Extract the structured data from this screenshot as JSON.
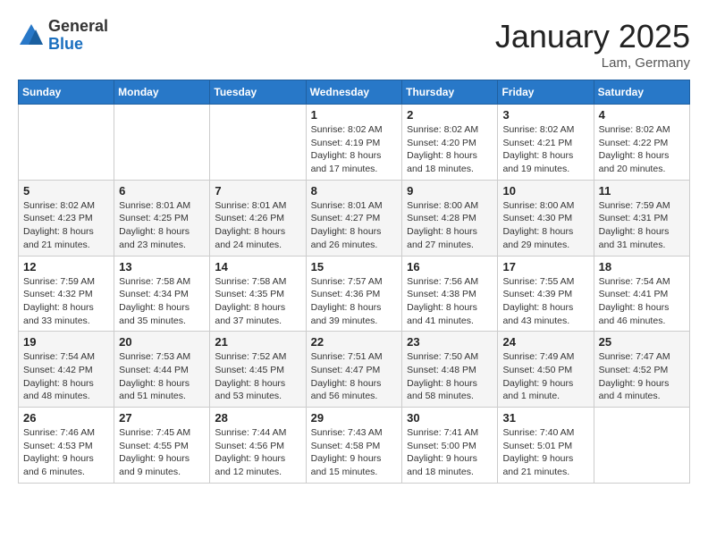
{
  "logo": {
    "general": "General",
    "blue": "Blue"
  },
  "header": {
    "month": "January 2025",
    "location": "Lam, Germany"
  },
  "weekdays": [
    "Sunday",
    "Monday",
    "Tuesday",
    "Wednesday",
    "Thursday",
    "Friday",
    "Saturday"
  ],
  "weeks": [
    [
      {
        "day": "",
        "info": ""
      },
      {
        "day": "",
        "info": ""
      },
      {
        "day": "",
        "info": ""
      },
      {
        "day": "1",
        "info": "Sunrise: 8:02 AM\nSunset: 4:19 PM\nDaylight: 8 hours\nand 17 minutes."
      },
      {
        "day": "2",
        "info": "Sunrise: 8:02 AM\nSunset: 4:20 PM\nDaylight: 8 hours\nand 18 minutes."
      },
      {
        "day": "3",
        "info": "Sunrise: 8:02 AM\nSunset: 4:21 PM\nDaylight: 8 hours\nand 19 minutes."
      },
      {
        "day": "4",
        "info": "Sunrise: 8:02 AM\nSunset: 4:22 PM\nDaylight: 8 hours\nand 20 minutes."
      }
    ],
    [
      {
        "day": "5",
        "info": "Sunrise: 8:02 AM\nSunset: 4:23 PM\nDaylight: 8 hours\nand 21 minutes."
      },
      {
        "day": "6",
        "info": "Sunrise: 8:01 AM\nSunset: 4:25 PM\nDaylight: 8 hours\nand 23 minutes."
      },
      {
        "day": "7",
        "info": "Sunrise: 8:01 AM\nSunset: 4:26 PM\nDaylight: 8 hours\nand 24 minutes."
      },
      {
        "day": "8",
        "info": "Sunrise: 8:01 AM\nSunset: 4:27 PM\nDaylight: 8 hours\nand 26 minutes."
      },
      {
        "day": "9",
        "info": "Sunrise: 8:00 AM\nSunset: 4:28 PM\nDaylight: 8 hours\nand 27 minutes."
      },
      {
        "day": "10",
        "info": "Sunrise: 8:00 AM\nSunset: 4:30 PM\nDaylight: 8 hours\nand 29 minutes."
      },
      {
        "day": "11",
        "info": "Sunrise: 7:59 AM\nSunset: 4:31 PM\nDaylight: 8 hours\nand 31 minutes."
      }
    ],
    [
      {
        "day": "12",
        "info": "Sunrise: 7:59 AM\nSunset: 4:32 PM\nDaylight: 8 hours\nand 33 minutes."
      },
      {
        "day": "13",
        "info": "Sunrise: 7:58 AM\nSunset: 4:34 PM\nDaylight: 8 hours\nand 35 minutes."
      },
      {
        "day": "14",
        "info": "Sunrise: 7:58 AM\nSunset: 4:35 PM\nDaylight: 8 hours\nand 37 minutes."
      },
      {
        "day": "15",
        "info": "Sunrise: 7:57 AM\nSunset: 4:36 PM\nDaylight: 8 hours\nand 39 minutes."
      },
      {
        "day": "16",
        "info": "Sunrise: 7:56 AM\nSunset: 4:38 PM\nDaylight: 8 hours\nand 41 minutes."
      },
      {
        "day": "17",
        "info": "Sunrise: 7:55 AM\nSunset: 4:39 PM\nDaylight: 8 hours\nand 43 minutes."
      },
      {
        "day": "18",
        "info": "Sunrise: 7:54 AM\nSunset: 4:41 PM\nDaylight: 8 hours\nand 46 minutes."
      }
    ],
    [
      {
        "day": "19",
        "info": "Sunrise: 7:54 AM\nSunset: 4:42 PM\nDaylight: 8 hours\nand 48 minutes."
      },
      {
        "day": "20",
        "info": "Sunrise: 7:53 AM\nSunset: 4:44 PM\nDaylight: 8 hours\nand 51 minutes."
      },
      {
        "day": "21",
        "info": "Sunrise: 7:52 AM\nSunset: 4:45 PM\nDaylight: 8 hours\nand 53 minutes."
      },
      {
        "day": "22",
        "info": "Sunrise: 7:51 AM\nSunset: 4:47 PM\nDaylight: 8 hours\nand 56 minutes."
      },
      {
        "day": "23",
        "info": "Sunrise: 7:50 AM\nSunset: 4:48 PM\nDaylight: 8 hours\nand 58 minutes."
      },
      {
        "day": "24",
        "info": "Sunrise: 7:49 AM\nSunset: 4:50 PM\nDaylight: 9 hours\nand 1 minute."
      },
      {
        "day": "25",
        "info": "Sunrise: 7:47 AM\nSunset: 4:52 PM\nDaylight: 9 hours\nand 4 minutes."
      }
    ],
    [
      {
        "day": "26",
        "info": "Sunrise: 7:46 AM\nSunset: 4:53 PM\nDaylight: 9 hours\nand 6 minutes."
      },
      {
        "day": "27",
        "info": "Sunrise: 7:45 AM\nSunset: 4:55 PM\nDaylight: 9 hours\nand 9 minutes."
      },
      {
        "day": "28",
        "info": "Sunrise: 7:44 AM\nSunset: 4:56 PM\nDaylight: 9 hours\nand 12 minutes."
      },
      {
        "day": "29",
        "info": "Sunrise: 7:43 AM\nSunset: 4:58 PM\nDaylight: 9 hours\nand 15 minutes."
      },
      {
        "day": "30",
        "info": "Sunrise: 7:41 AM\nSunset: 5:00 PM\nDaylight: 9 hours\nand 18 minutes."
      },
      {
        "day": "31",
        "info": "Sunrise: 7:40 AM\nSunset: 5:01 PM\nDaylight: 9 hours\nand 21 minutes."
      },
      {
        "day": "",
        "info": ""
      }
    ]
  ]
}
